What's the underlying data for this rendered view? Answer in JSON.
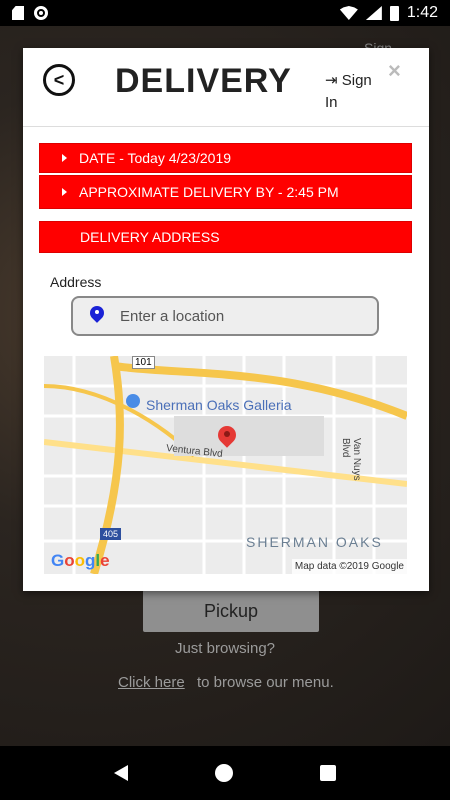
{
  "status_bar": {
    "time": "1:42",
    "icons": [
      "sd-card-icon",
      "circle-icon",
      "wifi-icon",
      "signal-icon",
      "battery-icon"
    ]
  },
  "background": {
    "sign_in": "Sign",
    "pickup_label": "Pickup",
    "browsing_text": "Just browsing?",
    "click_here_label": "Click here",
    "browse_text": "to browse our menu."
  },
  "modal": {
    "title": "DELIVERY",
    "sign_in_label": "Sign In",
    "close_label": "×",
    "date_bar": "DATE - Today 4/23/2019",
    "approx_bar": "APPROXIMATE DELIVERY BY - 2:45 PM",
    "address_section": "DELIVERY ADDRESS",
    "address_label": "Address",
    "address_placeholder": "Enter a location",
    "colors": {
      "accent": "#ff0000",
      "pin": "#1a22d6"
    }
  },
  "map": {
    "poi_label": "Sherman Oaks Galleria",
    "street_label": "Ventura Blvd",
    "street2_label": "Van Nuys Blvd",
    "area_label": "SHERMAN OAKS",
    "hwy_101": "101",
    "hwy_405": "405",
    "google": [
      "G",
      "o",
      "o",
      "g",
      "l",
      "e"
    ],
    "attribution": "Map data ©2019 Google"
  }
}
